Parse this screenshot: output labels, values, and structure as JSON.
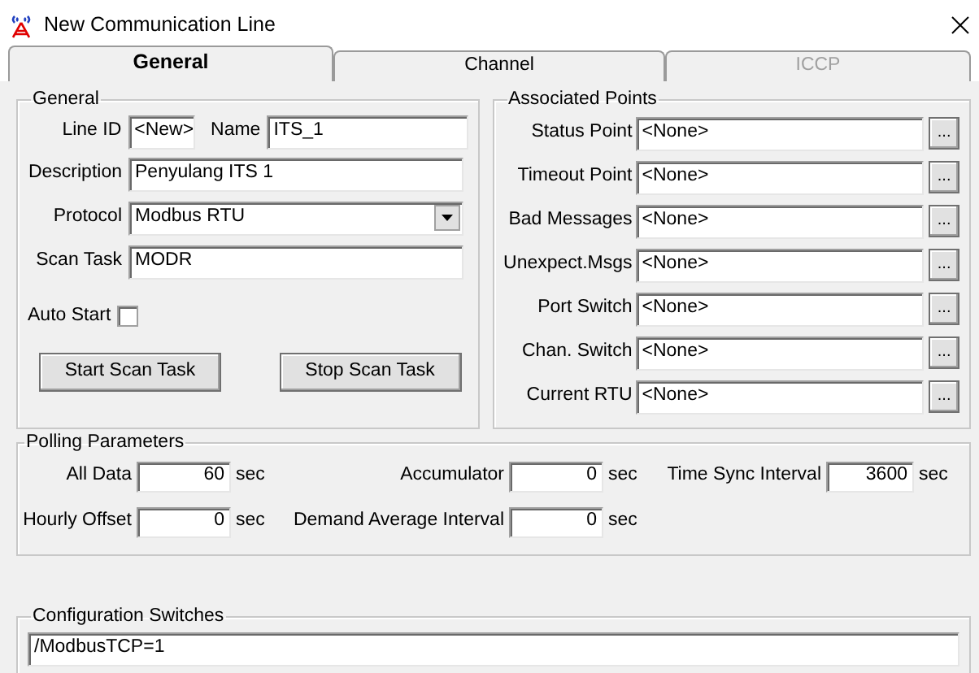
{
  "window": {
    "title": "New Communication Line"
  },
  "tabs": [
    {
      "label": "General",
      "selected": true,
      "disabled": false
    },
    {
      "label": "Channel",
      "selected": false,
      "disabled": false
    },
    {
      "label": "ICCP",
      "selected": false,
      "disabled": true
    }
  ],
  "general": {
    "title": "General",
    "line_id_label": "Line ID",
    "line_id": "<New>",
    "name_label": "Name",
    "name": "ITS_1",
    "description_label": "Description",
    "description": "Penyulang ITS 1",
    "protocol_label": "Protocol",
    "protocol": "Modbus RTU",
    "scan_task_label": "Scan Task",
    "scan_task": "MODR",
    "auto_start_label": "Auto Start",
    "auto_start": false,
    "buttons": [
      "Start Scan Task",
      "Stop Scan Task"
    ]
  },
  "associated_points": {
    "title": "Associated Points",
    "rows": [
      {
        "label": "Status Point",
        "value": "<None>",
        "button": "..."
      },
      {
        "label": "Timeout Point",
        "value": "<None>",
        "button": "..."
      },
      {
        "label": "Bad Messages",
        "value": "<None>",
        "button": "..."
      },
      {
        "label": "Unexpect.Msgs",
        "value": "<None>",
        "button": "..."
      },
      {
        "label": "Port Switch",
        "value": "<None>",
        "button": "..."
      },
      {
        "label": "Chan. Switch",
        "value": "<None>",
        "button": "..."
      },
      {
        "label": "Current RTU",
        "value": "<None>",
        "button": "..."
      }
    ]
  },
  "polling": {
    "title": "Polling Parameters",
    "rows": [
      [
        {
          "label": "All Data",
          "value": "60",
          "unit": "sec"
        },
        {
          "label": "Accumulator",
          "value": "0",
          "unit": "sec"
        },
        {
          "label": "Time Sync Interval",
          "value": "3600",
          "unit": "sec"
        }
      ],
      [
        {
          "label": "Hourly Offset",
          "value": "0",
          "unit": "sec"
        },
        {
          "label": "Demand Average Interval",
          "value": "0",
          "unit": "sec"
        }
      ]
    ]
  },
  "config": {
    "title": "Configuration Switches",
    "value": "/ModbusTCP=1"
  }
}
